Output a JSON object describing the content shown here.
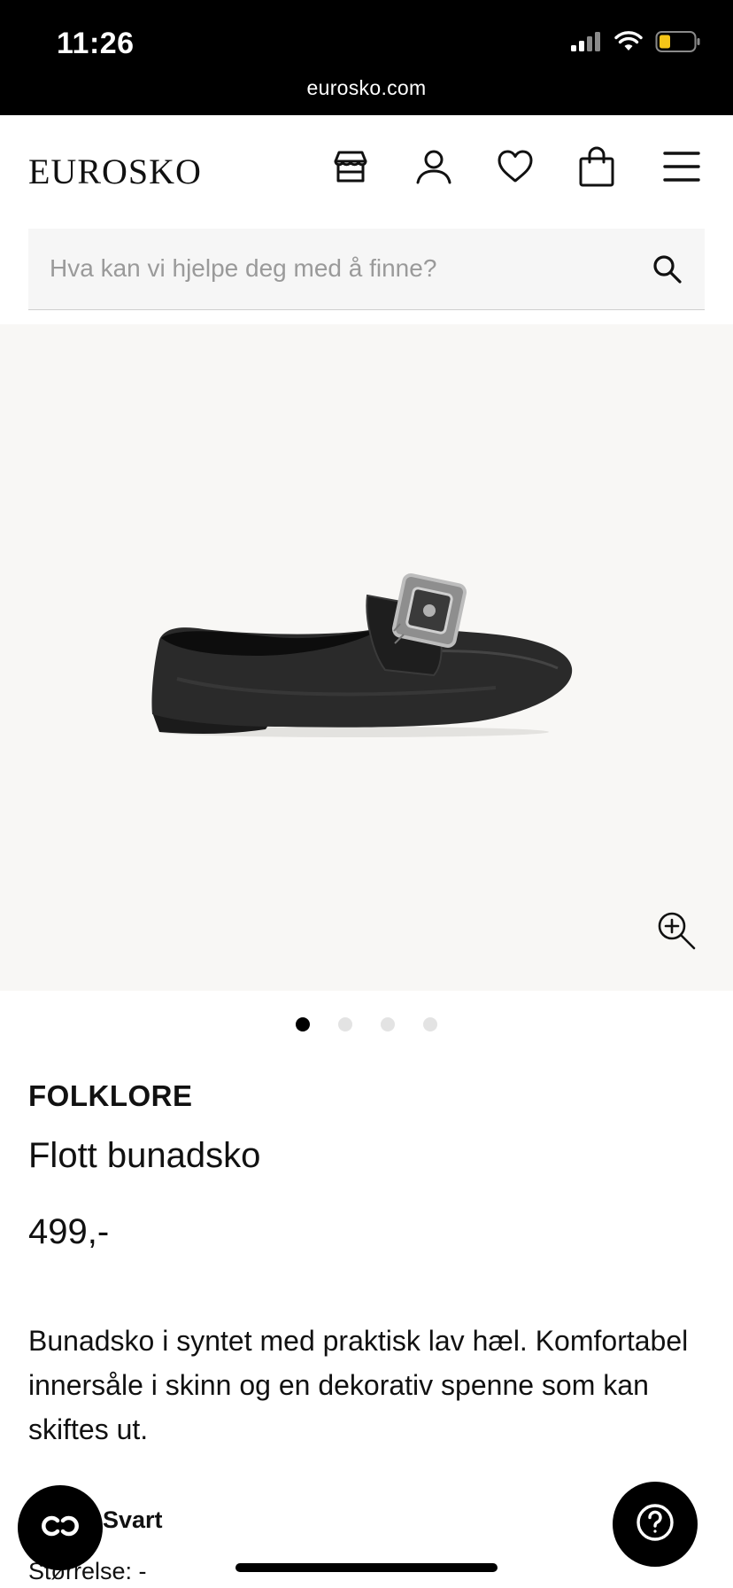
{
  "status_bar": {
    "time": "11:26",
    "url": "eurosko.com",
    "icons": [
      "signal-icon",
      "wifi-icon",
      "battery-icon"
    ],
    "battery_color": "#f5c518"
  },
  "header": {
    "logo": "EUROSKO",
    "icons": [
      "store-icon",
      "account-icon",
      "heart-icon",
      "bag-icon",
      "menu-icon"
    ]
  },
  "search": {
    "placeholder": "Hva kan vi hjelpe deg med å finne?",
    "value": ""
  },
  "gallery": {
    "image": "black-bunad-shoe-with-silver-buckle",
    "current_slide": 1,
    "total_slides": 4
  },
  "product": {
    "brand": "FOLKLORE",
    "name": "Flott bunadsko",
    "price": "499,-",
    "description": "Bunadsko i syntet med praktisk lav hæl. Komfortabel innersåle i skinn og en dekorativ spenne som kan skiftes ut.",
    "color": "Svart",
    "size": "Størrelse: -"
  },
  "floating": {
    "left_icon": "chat-link-icon",
    "right_icon": "help-icon"
  }
}
